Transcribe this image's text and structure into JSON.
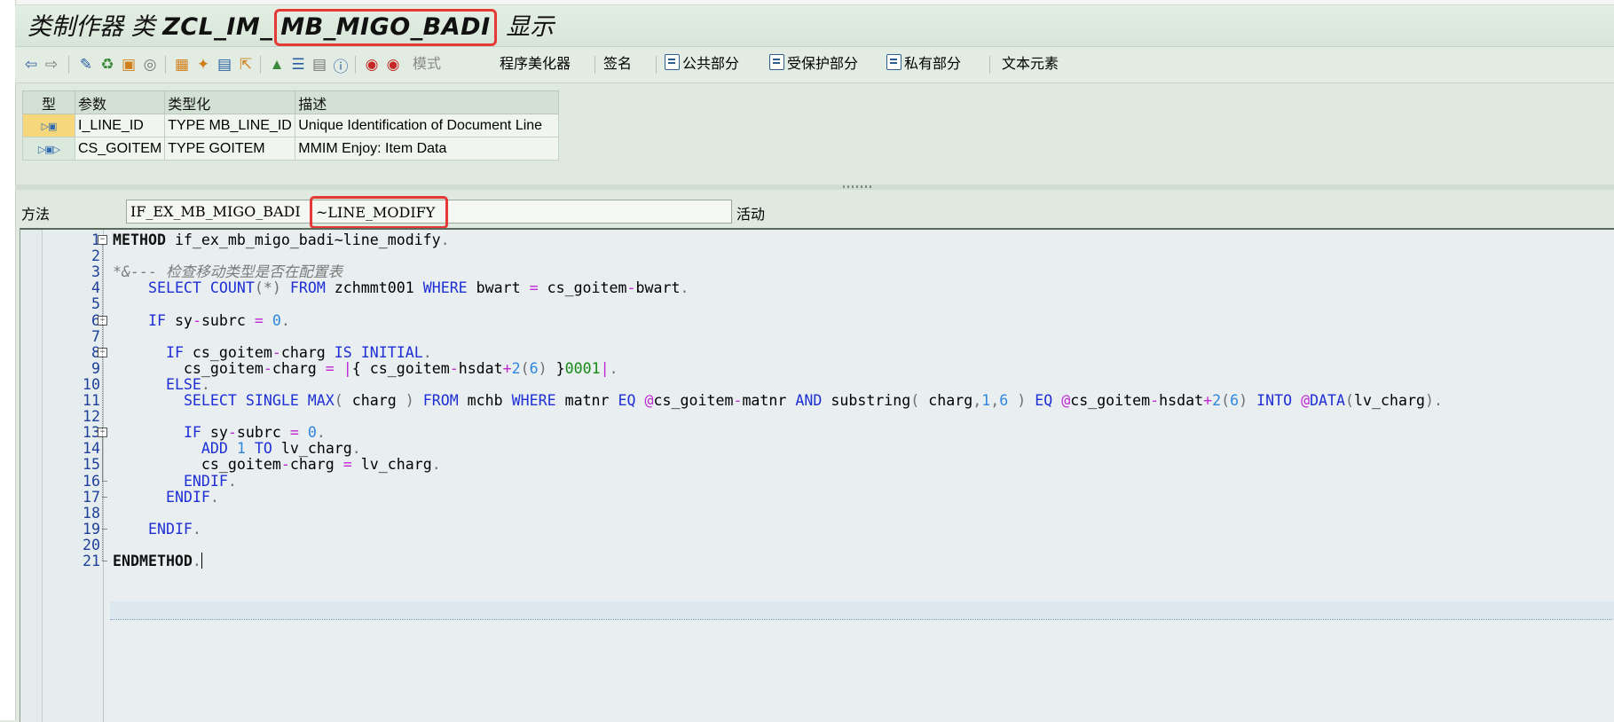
{
  "title": {
    "prefix": "类制作器 类",
    "class_name_part1": "ZCL_IM_",
    "class_name_part2": "MB_MIGO_BADI",
    "suffix": "显示"
  },
  "toolbar": {
    "icons": [
      "back-icon",
      "forward-icon",
      "other-object-icon",
      "display-change-icon",
      "activate-icon",
      "where-used-icon",
      "object-list-icon",
      "navigate-icon",
      "bookmark-icon",
      "check-icon",
      "test-icon",
      "hierarchy-icon",
      "outline-icon",
      "documentation-icon",
      "info-icon",
      "breakpoint-icon",
      "session-breakpoint-icon"
    ],
    "pattern_label": "模式",
    "pretty_printer_label": "程序美化器",
    "signature_label": "签名",
    "public_section_label": "公共部分",
    "protected_section_label": "受保护部分",
    "private_section_label": "私有部分",
    "text_elements_label": "文本元素"
  },
  "params": {
    "headers": [
      "型",
      "参数",
      "类型化",
      "描述"
    ],
    "rows": [
      {
        "kind": "importing",
        "name": "I_LINE_ID",
        "typing": "TYPE MB_LINE_ID",
        "description": "Unique Identification of Document Line"
      },
      {
        "kind": "changing",
        "name": "CS_GOITEM",
        "typing": "TYPE GOITEM",
        "description": "MMIM Enjoy: Item Data"
      }
    ]
  },
  "method": {
    "label": "方法",
    "interface_part": "IF_EX_MB_MIGO_BADI",
    "method_part": "~LINE_MODIFY",
    "status": "活动"
  },
  "code": {
    "line_numbers": [
      "1",
      "2",
      "3",
      "4",
      "5",
      "6",
      "7",
      "8",
      "9",
      "10",
      "11",
      "12",
      "13",
      "14",
      "15",
      "16",
      "17",
      "18",
      "19",
      "20",
      "21"
    ],
    "lines": [
      [
        [
          "kwb",
          "METHOD"
        ],
        [
          "t",
          " if_ex_mb_migo_badi~line_modify"
        ],
        [
          "gray",
          "."
        ]
      ],
      [],
      [
        [
          "cm",
          "*&--- 检查移动类型是否在配置表"
        ]
      ],
      [
        [
          "t",
          "    "
        ],
        [
          "kw",
          "SELECT COUNT"
        ],
        [
          "gray",
          "(*)"
        ],
        [
          "t",
          " "
        ],
        [
          "kw",
          "FROM"
        ],
        [
          "t",
          " zchmmt001 "
        ],
        [
          "kw",
          "WHERE"
        ],
        [
          "t",
          " bwart "
        ],
        [
          "op",
          "="
        ],
        [
          "t",
          " cs_goitem"
        ],
        [
          "op",
          "-"
        ],
        [
          "t",
          "bwart"
        ],
        [
          "gray",
          "."
        ]
      ],
      [],
      [
        [
          "t",
          "    "
        ],
        [
          "kw",
          "IF"
        ],
        [
          "t",
          " sy"
        ],
        [
          "op",
          "-"
        ],
        [
          "t",
          "subrc "
        ],
        [
          "op",
          "="
        ],
        [
          "t",
          " "
        ],
        [
          "num",
          "0"
        ],
        [
          "gray",
          "."
        ]
      ],
      [],
      [
        [
          "t",
          "      "
        ],
        [
          "kw",
          "IF"
        ],
        [
          "t",
          " cs_goitem"
        ],
        [
          "op",
          "-"
        ],
        [
          "t",
          "charg "
        ],
        [
          "kw",
          "IS INITIAL"
        ],
        [
          "gray",
          "."
        ]
      ],
      [
        [
          "t",
          "        cs_goitem"
        ],
        [
          "op",
          "-"
        ],
        [
          "t",
          "charg "
        ],
        [
          "op",
          "="
        ],
        [
          "t",
          " "
        ],
        [
          "op",
          "|"
        ],
        [
          "t",
          "{ cs_goitem"
        ],
        [
          "op",
          "-"
        ],
        [
          "t",
          "hsdat"
        ],
        [
          "op",
          "+"
        ],
        [
          "num",
          "2"
        ],
        [
          "gray",
          "("
        ],
        [
          "num",
          "6"
        ],
        [
          "gray",
          ")"
        ],
        [
          "t",
          " }"
        ],
        [
          "lit",
          "0001"
        ],
        [
          "op",
          "|"
        ],
        [
          "gray",
          "."
        ]
      ],
      [
        [
          "t",
          "      "
        ],
        [
          "kw",
          "ELSE"
        ],
        [
          "gray",
          "."
        ]
      ],
      [
        [
          "t",
          "        "
        ],
        [
          "kw",
          "SELECT SINGLE MAX"
        ],
        [
          "gray",
          "("
        ],
        [
          "t",
          " charg "
        ],
        [
          "gray",
          ")"
        ],
        [
          "t",
          " "
        ],
        [
          "kw",
          "FROM"
        ],
        [
          "t",
          " mchb "
        ],
        [
          "kw",
          "WHERE"
        ],
        [
          "t",
          " matnr "
        ],
        [
          "kw",
          "EQ"
        ],
        [
          "t",
          " "
        ],
        [
          "op",
          "@"
        ],
        [
          "t",
          "cs_goitem"
        ],
        [
          "op",
          "-"
        ],
        [
          "t",
          "matnr "
        ],
        [
          "kw",
          "AND"
        ],
        [
          "t",
          " substring"
        ],
        [
          "gray",
          "("
        ],
        [
          "t",
          " charg"
        ],
        [
          "gray",
          ","
        ],
        [
          "num",
          "1"
        ],
        [
          "gray",
          ","
        ],
        [
          "num",
          "6"
        ],
        [
          "t",
          " "
        ],
        [
          "gray",
          ")"
        ],
        [
          "t",
          " "
        ],
        [
          "kw",
          "EQ"
        ],
        [
          "t",
          " "
        ],
        [
          "op",
          "@"
        ],
        [
          "t",
          "cs_goitem"
        ],
        [
          "op",
          "-"
        ],
        [
          "t",
          "hsdat"
        ],
        [
          "op",
          "+"
        ],
        [
          "num",
          "2"
        ],
        [
          "gray",
          "("
        ],
        [
          "num",
          "6"
        ],
        [
          "gray",
          ")"
        ],
        [
          "t",
          " "
        ],
        [
          "kw",
          "INTO"
        ],
        [
          "t",
          " "
        ],
        [
          "op",
          "@"
        ],
        [
          "kw",
          "DATA"
        ],
        [
          "gray",
          "("
        ],
        [
          "t",
          "lv_charg"
        ],
        [
          "gray",
          ")."
        ]
      ],
      [],
      [
        [
          "t",
          "        "
        ],
        [
          "kw",
          "IF"
        ],
        [
          "t",
          " sy"
        ],
        [
          "op",
          "-"
        ],
        [
          "t",
          "subrc "
        ],
        [
          "op",
          "="
        ],
        [
          "t",
          " "
        ],
        [
          "num",
          "0"
        ],
        [
          "gray",
          "."
        ]
      ],
      [
        [
          "t",
          "          "
        ],
        [
          "kw",
          "ADD"
        ],
        [
          "t",
          " "
        ],
        [
          "num",
          "1"
        ],
        [
          "t",
          " "
        ],
        [
          "kw",
          "TO"
        ],
        [
          "t",
          " lv_charg"
        ],
        [
          "gray",
          "."
        ]
      ],
      [
        [
          "t",
          "          cs_goitem"
        ],
        [
          "op",
          "-"
        ],
        [
          "t",
          "charg "
        ],
        [
          "op",
          "="
        ],
        [
          "t",
          " lv_charg"
        ],
        [
          "gray",
          "."
        ]
      ],
      [
        [
          "t",
          "        "
        ],
        [
          "kw",
          "ENDIF"
        ],
        [
          "gray",
          "."
        ]
      ],
      [
        [
          "t",
          "      "
        ],
        [
          "kw",
          "ENDIF"
        ],
        [
          "gray",
          "."
        ]
      ],
      [],
      [
        [
          "t",
          "    "
        ],
        [
          "kw",
          "ENDIF"
        ],
        [
          "gray",
          "."
        ]
      ],
      [],
      [
        [
          "kwb",
          "ENDMETHOD"
        ],
        [
          "gray",
          "."
        ],
        [
          "caret",
          ""
        ]
      ]
    ]
  }
}
